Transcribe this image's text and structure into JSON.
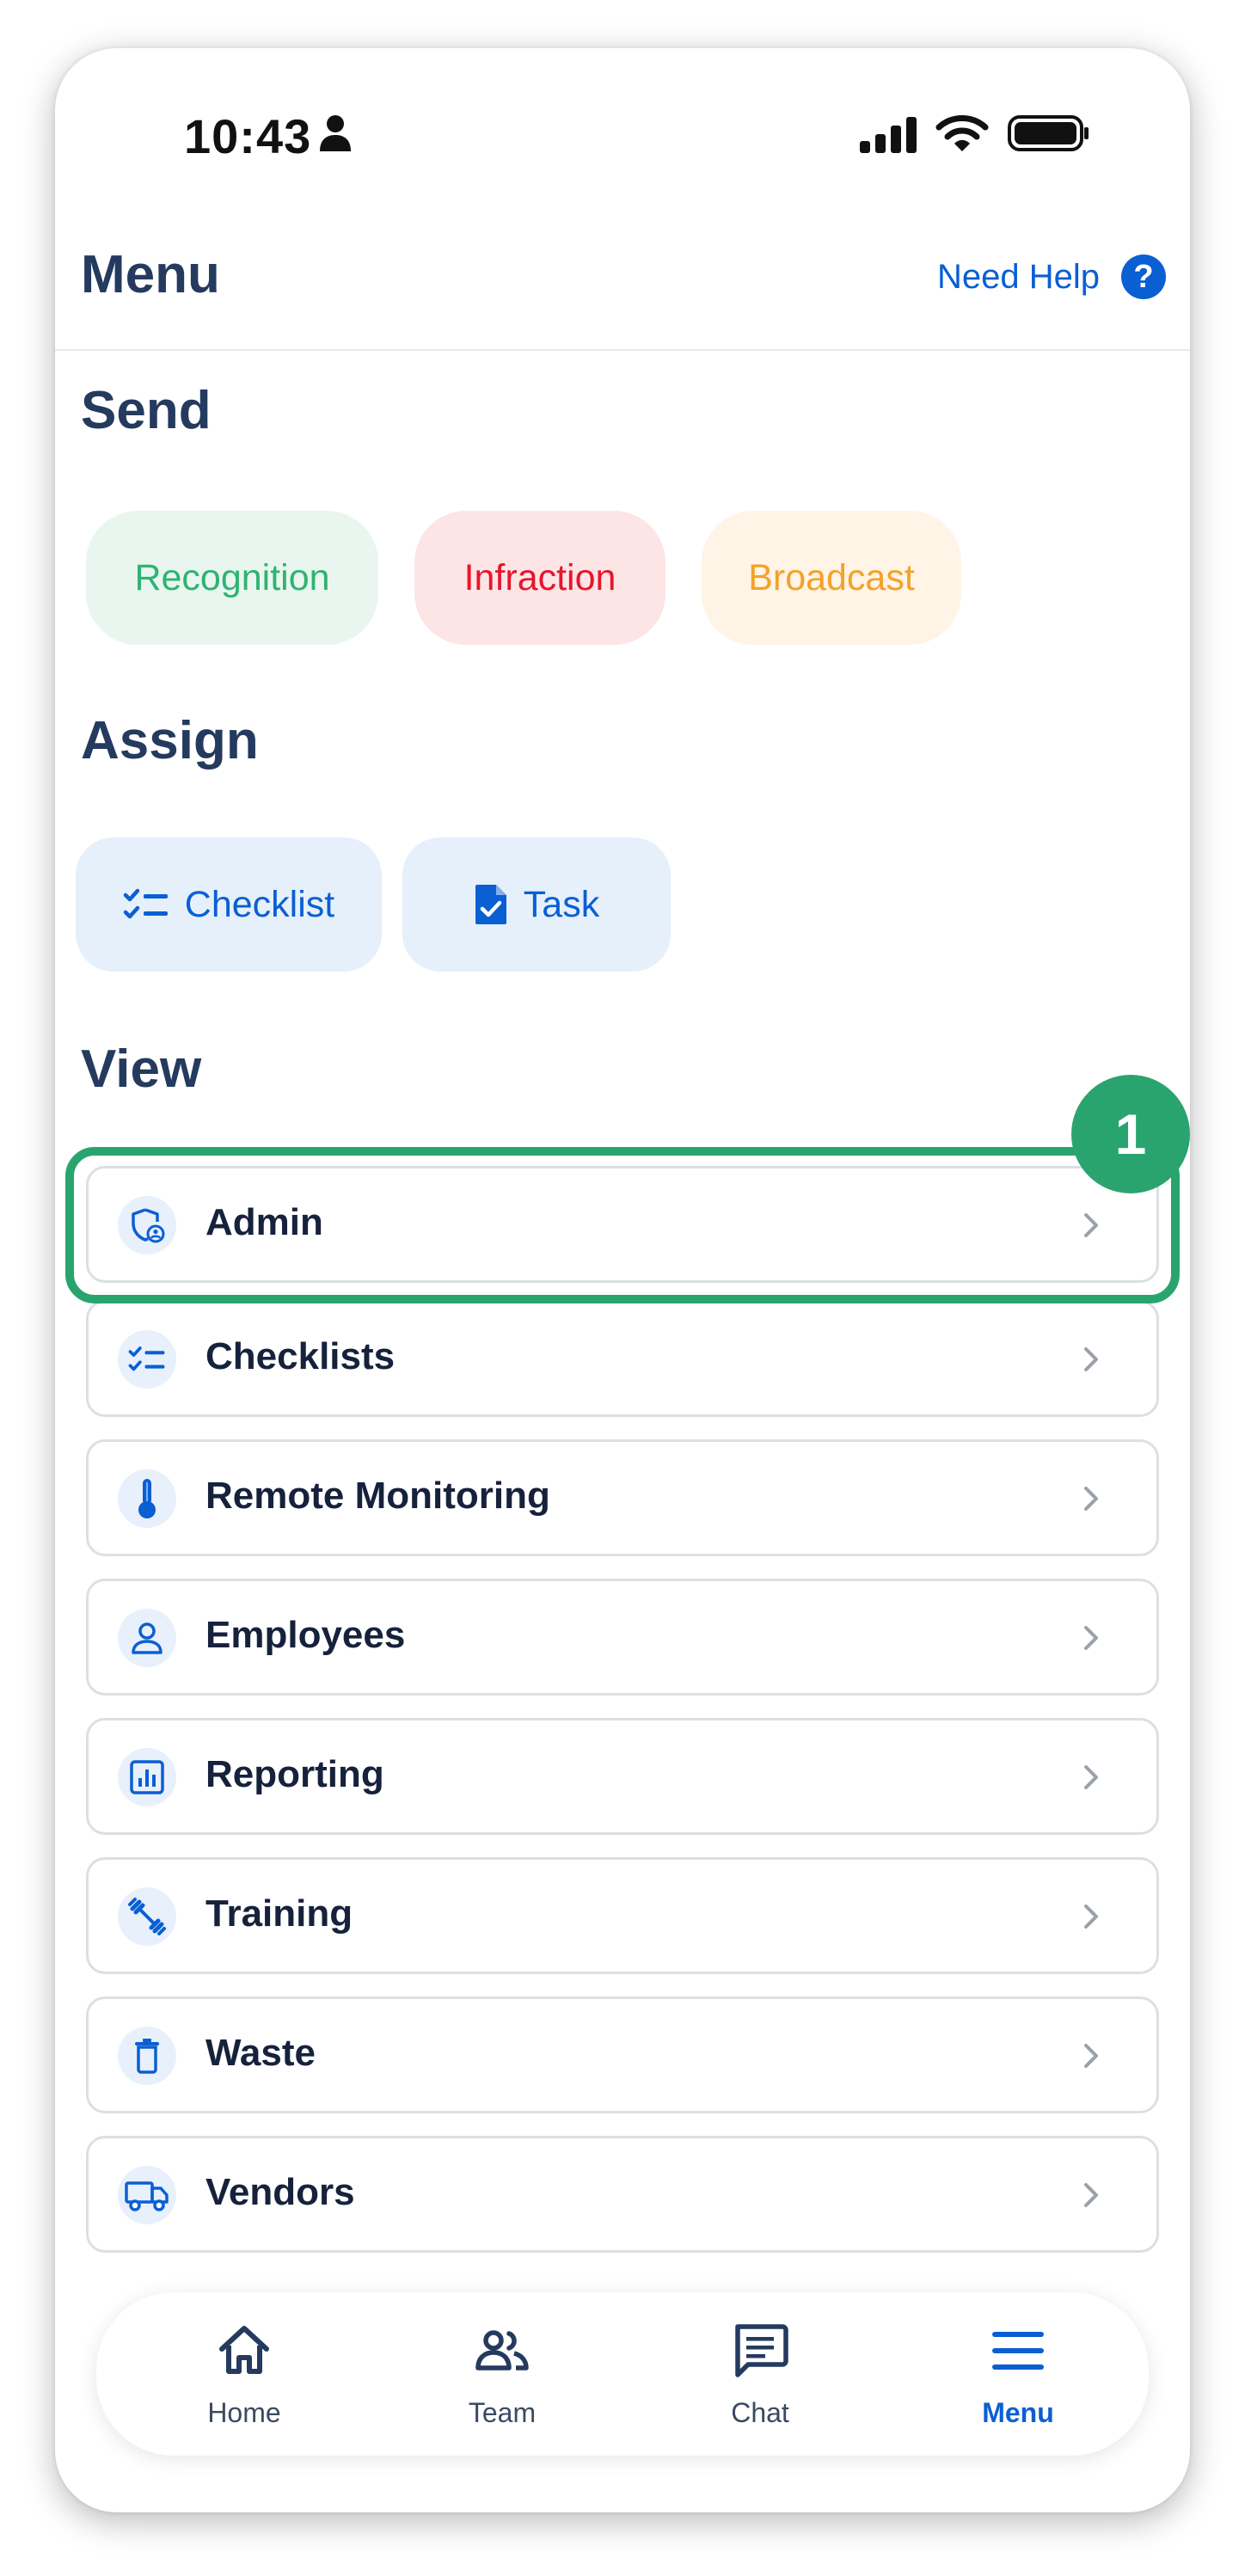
{
  "status_bar": {
    "time": "10:43"
  },
  "header": {
    "title": "Menu",
    "help_label": "Need Help",
    "help_icon_glyph": "?"
  },
  "send": {
    "title": "Send",
    "items": [
      {
        "label": "Recognition",
        "color": "#2fb372"
      },
      {
        "label": "Infraction",
        "color": "#e8152b"
      },
      {
        "label": "Broadcast",
        "color": "#f3a22a"
      }
    ]
  },
  "assign": {
    "title": "Assign",
    "items": [
      {
        "label": "Checklist",
        "icon": "checklist-icon"
      },
      {
        "label": "Task",
        "icon": "task-file-icon"
      }
    ]
  },
  "view": {
    "title": "View",
    "items": [
      {
        "label": "Admin",
        "icon": "admin-shield-icon"
      },
      {
        "label": "Checklists",
        "icon": "checklist-icon"
      },
      {
        "label": "Remote Monitoring",
        "icon": "thermometer-icon"
      },
      {
        "label": "Employees",
        "icon": "person-icon"
      },
      {
        "label": "Reporting",
        "icon": "bar-chart-icon"
      },
      {
        "label": "Training",
        "icon": "dumbbell-icon"
      },
      {
        "label": "Waste",
        "icon": "trash-icon"
      },
      {
        "label": "Vendors",
        "icon": "truck-icon"
      }
    ]
  },
  "annotation": {
    "step": "1",
    "color": "#2aa46e"
  },
  "bottom_nav": {
    "items": [
      {
        "label": "Home",
        "icon": "home-icon"
      },
      {
        "label": "Team",
        "icon": "team-icon"
      },
      {
        "label": "Chat",
        "icon": "chat-icon"
      },
      {
        "label": "Menu",
        "icon": "menu-icon",
        "active": true
      }
    ]
  },
  "colors": {
    "accent": "#0a5fd3",
    "heading": "#243a5e"
  }
}
